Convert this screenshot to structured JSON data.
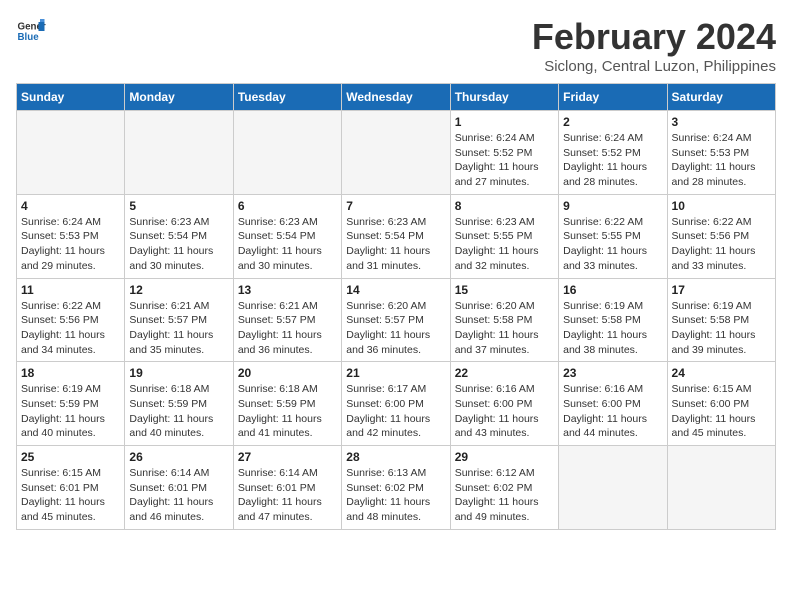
{
  "header": {
    "logo_line1": "General",
    "logo_line2": "Blue",
    "month_year": "February 2024",
    "location": "Siclong, Central Luzon, Philippines"
  },
  "weekdays": [
    "Sunday",
    "Monday",
    "Tuesday",
    "Wednesday",
    "Thursday",
    "Friday",
    "Saturday"
  ],
  "weeks": [
    [
      {
        "day": "",
        "info": ""
      },
      {
        "day": "",
        "info": ""
      },
      {
        "day": "",
        "info": ""
      },
      {
        "day": "",
        "info": ""
      },
      {
        "day": "1",
        "info": "Sunrise: 6:24 AM\nSunset: 5:52 PM\nDaylight: 11 hours\nand 27 minutes."
      },
      {
        "day": "2",
        "info": "Sunrise: 6:24 AM\nSunset: 5:52 PM\nDaylight: 11 hours\nand 28 minutes."
      },
      {
        "day": "3",
        "info": "Sunrise: 6:24 AM\nSunset: 5:53 PM\nDaylight: 11 hours\nand 28 minutes."
      }
    ],
    [
      {
        "day": "4",
        "info": "Sunrise: 6:24 AM\nSunset: 5:53 PM\nDaylight: 11 hours\nand 29 minutes."
      },
      {
        "day": "5",
        "info": "Sunrise: 6:23 AM\nSunset: 5:54 PM\nDaylight: 11 hours\nand 30 minutes."
      },
      {
        "day": "6",
        "info": "Sunrise: 6:23 AM\nSunset: 5:54 PM\nDaylight: 11 hours\nand 30 minutes."
      },
      {
        "day": "7",
        "info": "Sunrise: 6:23 AM\nSunset: 5:54 PM\nDaylight: 11 hours\nand 31 minutes."
      },
      {
        "day": "8",
        "info": "Sunrise: 6:23 AM\nSunset: 5:55 PM\nDaylight: 11 hours\nand 32 minutes."
      },
      {
        "day": "9",
        "info": "Sunrise: 6:22 AM\nSunset: 5:55 PM\nDaylight: 11 hours\nand 33 minutes."
      },
      {
        "day": "10",
        "info": "Sunrise: 6:22 AM\nSunset: 5:56 PM\nDaylight: 11 hours\nand 33 minutes."
      }
    ],
    [
      {
        "day": "11",
        "info": "Sunrise: 6:22 AM\nSunset: 5:56 PM\nDaylight: 11 hours\nand 34 minutes."
      },
      {
        "day": "12",
        "info": "Sunrise: 6:21 AM\nSunset: 5:57 PM\nDaylight: 11 hours\nand 35 minutes."
      },
      {
        "day": "13",
        "info": "Sunrise: 6:21 AM\nSunset: 5:57 PM\nDaylight: 11 hours\nand 36 minutes."
      },
      {
        "day": "14",
        "info": "Sunrise: 6:20 AM\nSunset: 5:57 PM\nDaylight: 11 hours\nand 36 minutes."
      },
      {
        "day": "15",
        "info": "Sunrise: 6:20 AM\nSunset: 5:58 PM\nDaylight: 11 hours\nand 37 minutes."
      },
      {
        "day": "16",
        "info": "Sunrise: 6:19 AM\nSunset: 5:58 PM\nDaylight: 11 hours\nand 38 minutes."
      },
      {
        "day": "17",
        "info": "Sunrise: 6:19 AM\nSunset: 5:58 PM\nDaylight: 11 hours\nand 39 minutes."
      }
    ],
    [
      {
        "day": "18",
        "info": "Sunrise: 6:19 AM\nSunset: 5:59 PM\nDaylight: 11 hours\nand 40 minutes."
      },
      {
        "day": "19",
        "info": "Sunrise: 6:18 AM\nSunset: 5:59 PM\nDaylight: 11 hours\nand 40 minutes."
      },
      {
        "day": "20",
        "info": "Sunrise: 6:18 AM\nSunset: 5:59 PM\nDaylight: 11 hours\nand 41 minutes."
      },
      {
        "day": "21",
        "info": "Sunrise: 6:17 AM\nSunset: 6:00 PM\nDaylight: 11 hours\nand 42 minutes."
      },
      {
        "day": "22",
        "info": "Sunrise: 6:16 AM\nSunset: 6:00 PM\nDaylight: 11 hours\nand 43 minutes."
      },
      {
        "day": "23",
        "info": "Sunrise: 6:16 AM\nSunset: 6:00 PM\nDaylight: 11 hours\nand 44 minutes."
      },
      {
        "day": "24",
        "info": "Sunrise: 6:15 AM\nSunset: 6:00 PM\nDaylight: 11 hours\nand 45 minutes."
      }
    ],
    [
      {
        "day": "25",
        "info": "Sunrise: 6:15 AM\nSunset: 6:01 PM\nDaylight: 11 hours\nand 45 minutes."
      },
      {
        "day": "26",
        "info": "Sunrise: 6:14 AM\nSunset: 6:01 PM\nDaylight: 11 hours\nand 46 minutes."
      },
      {
        "day": "27",
        "info": "Sunrise: 6:14 AM\nSunset: 6:01 PM\nDaylight: 11 hours\nand 47 minutes."
      },
      {
        "day": "28",
        "info": "Sunrise: 6:13 AM\nSunset: 6:02 PM\nDaylight: 11 hours\nand 48 minutes."
      },
      {
        "day": "29",
        "info": "Sunrise: 6:12 AM\nSunset: 6:02 PM\nDaylight: 11 hours\nand 49 minutes."
      },
      {
        "day": "",
        "info": ""
      },
      {
        "day": "",
        "info": ""
      }
    ]
  ]
}
